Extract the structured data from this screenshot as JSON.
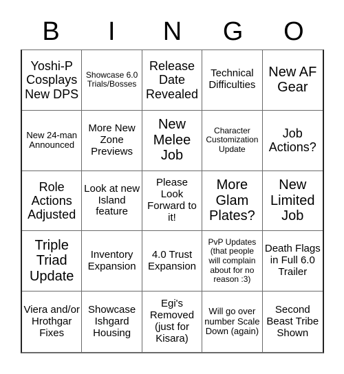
{
  "header": {
    "letters": [
      "B",
      "I",
      "N",
      "G",
      "O"
    ]
  },
  "cells": [
    {
      "text": "Yoshi-P Cosplays New DPS",
      "size": "l"
    },
    {
      "text": "Showcase 6.0 Trials/Bosses",
      "size": "xs"
    },
    {
      "text": "Release Date Revealed",
      "size": "l"
    },
    {
      "text": "Technical Difficulties",
      "size": "m"
    },
    {
      "text": "New AF Gear",
      "size": "xl"
    },
    {
      "text": "New 24-man Announced",
      "size": "s"
    },
    {
      "text": "More New Zone Previews",
      "size": "m"
    },
    {
      "text": "New Melee Job",
      "size": "xl"
    },
    {
      "text": "Character Customization Update",
      "size": "xs"
    },
    {
      "text": "Job Actions?",
      "size": "l"
    },
    {
      "text": "Role Actions Adjusted",
      "size": "l"
    },
    {
      "text": "Look at new Island feature",
      "size": "m"
    },
    {
      "text": "Please Look Forward to it!",
      "size": "m"
    },
    {
      "text": "More Glam Plates?",
      "size": "xl"
    },
    {
      "text": "New Limited Job",
      "size": "xl"
    },
    {
      "text": "Triple Triad Update",
      "size": "xl"
    },
    {
      "text": "Inventory Expansion",
      "size": "m"
    },
    {
      "text": "4.0 Trust Expansion",
      "size": "m"
    },
    {
      "text": "PvP Updates (that people will complain about for no reason :3)",
      "size": "xs"
    },
    {
      "text": "Death Flags in Full 6.0 Trailer",
      "size": "m"
    },
    {
      "text": "Viera and/or Hrothgar Fixes",
      "size": "m"
    },
    {
      "text": "Showcase Ishgard Housing",
      "size": "m"
    },
    {
      "text": "Egi's Removed (just for Kisara)",
      "size": "m"
    },
    {
      "text": "Will go over number Scale Down (again)",
      "size": "s"
    },
    {
      "text": "Second Beast Tribe Shown",
      "size": "m"
    }
  ]
}
